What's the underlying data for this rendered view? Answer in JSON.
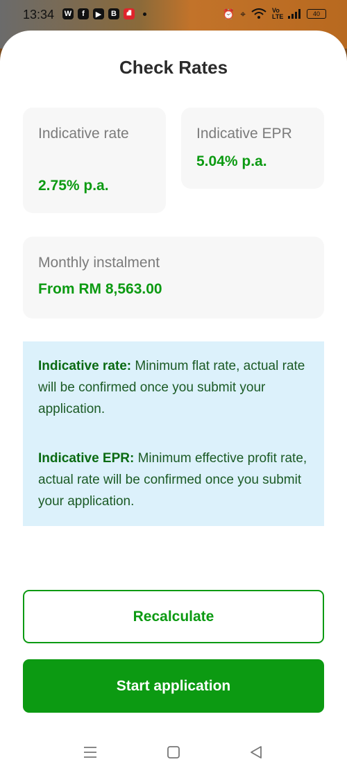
{
  "status_bar": {
    "time": "13:34",
    "app_badges": [
      "W",
      "f",
      "▶",
      "B",
      "⛘"
    ],
    "network": "Vo LTE",
    "battery": "40"
  },
  "sheet": {
    "title": "Check Rates",
    "cards": {
      "indicative_rate": {
        "label": "Indicative rate",
        "value": "2.75% p.a."
      },
      "indicative_epr": {
        "label": "Indicative EPR",
        "value": "5.04% p.a."
      },
      "monthly_instalment": {
        "label": "Monthly instalment",
        "value": "From RM 8,563.00"
      }
    },
    "info": {
      "rate_term": "Indicative rate:",
      "rate_text": " Minimum flat rate, actual rate will be confirmed once you submit your application.",
      "epr_term": "Indicative EPR:",
      "epr_text": " Minimum effective profit rate, actual rate will be confirmed once you submit your application."
    },
    "buttons": {
      "recalculate": "Recalculate",
      "start_application": "Start application"
    }
  },
  "colors": {
    "accent_green": "#0c9a12",
    "card_bg": "#f7f7f7",
    "info_bg": "#dcf1fb"
  },
  "nav_icons": [
    "menu-icon",
    "home-square-icon",
    "back-triangle-icon"
  ]
}
